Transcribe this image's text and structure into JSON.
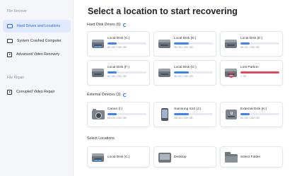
{
  "sidebar": {
    "sections": {
      "file_recover": "File Recover",
      "file_repair": "File Repair"
    },
    "items": [
      {
        "label": "Hard Drives and Locations",
        "icon": "hard-drive-icon",
        "active": true
      },
      {
        "label": "System Crashed Computer",
        "icon": "monitor-icon",
        "active": false
      },
      {
        "label": "Advanced Video Recovery",
        "icon": "video-icon",
        "active": false
      },
      {
        "label": "Corrupted Video Repair",
        "icon": "video-repair-icon",
        "active": false
      }
    ]
  },
  "main": {
    "title": "Select a location to start recovering",
    "hard_disk_section": "Hard Disk Drives (6)",
    "external_section": "External Devices (3)",
    "select_locations_section": "Select Locations",
    "hard_disks": [
      {
        "name": "Local Disk (C:)",
        "size": "60 GB / 250 GB",
        "used": 0.24,
        "icon": "windows-drive-icon"
      },
      {
        "name": "Local Disk (D:)",
        "size": "96 GB / 250 GB",
        "used": 0.38,
        "icon": "hard-drive-icon"
      },
      {
        "name": "Local Disk (E:)",
        "size": "60 GB / 250 GB",
        "used": 0.24,
        "icon": "hard-drive-icon"
      },
      {
        "name": "Local Disk (F:)",
        "size": "60 GB / 250 GB",
        "used": 0.24,
        "icon": "hard-drive-icon"
      },
      {
        "name": "Local Disk (G:)",
        "size": "96 GB / 250 GB",
        "used": 0.38,
        "icon": "hard-drive-icon"
      },
      {
        "name": "Lost Partion",
        "size": "1 TB",
        "used": 1.0,
        "icon": "lost-partition-icon",
        "color": "#e8485a"
      }
    ],
    "external_devices": [
      {
        "name": "Canon (I:)",
        "size": "60 GB / 250 GB",
        "used": 0.24,
        "icon": "camera-icon"
      },
      {
        "name": "Samsung S10 (J:)",
        "size": "96 GB / 250 GB",
        "used": 0.38,
        "icon": "phone-icon"
      },
      {
        "name": "External Disk (K:)",
        "size": "60 GB / 250 GB",
        "used": 0.24,
        "icon": "usb-drive-icon"
      }
    ],
    "locations": [
      {
        "name": "Local Disk (C:)",
        "icon": "windows-drive-icon"
      },
      {
        "name": "Desktop",
        "icon": "desktop-icon"
      },
      {
        "name": "Select Folder",
        "icon": "folder-icon"
      }
    ]
  },
  "colors": {
    "accent": "#2766e4",
    "bar_fill": "#3e82f7",
    "danger": "#e8485a"
  }
}
